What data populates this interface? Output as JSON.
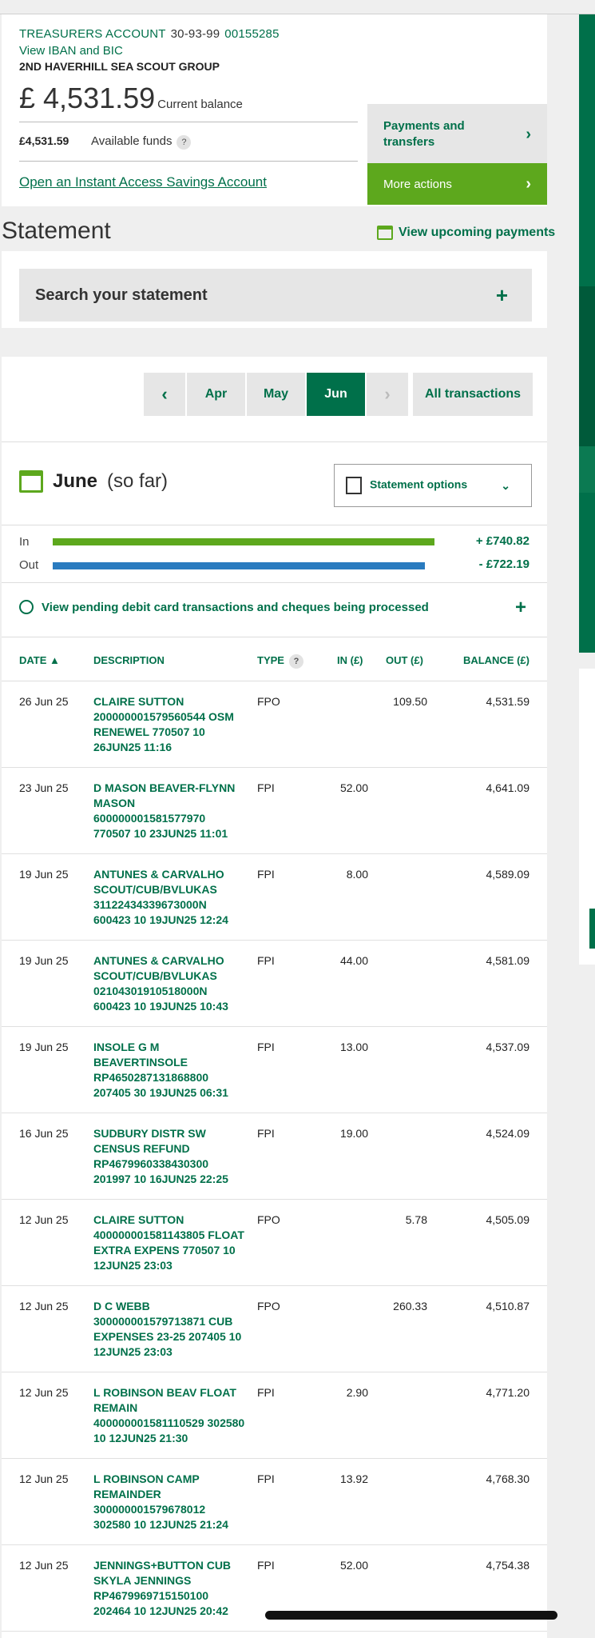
{
  "account": {
    "name": "TREASURERS ACCOUNT",
    "sort_code": "30-93-99",
    "number": "00155285",
    "iban_link": "View IBAN and BIC",
    "holder": "2ND HAVERHILL SEA SCOUT GROUP",
    "balance": "£ 4,531.59",
    "balance_label": "Current balance",
    "available": "£4,531.59",
    "available_label": "Available funds",
    "help": "?",
    "isa_link": "Open an Instant Access Savings Account",
    "payments_label": "Payments and transfers",
    "more_actions_label": "More actions"
  },
  "statement": {
    "title": "Statement",
    "upcoming_label": "View upcoming payments",
    "search_label": "Search your statement",
    "plus": "+"
  },
  "months": {
    "prev": "‹",
    "items": [
      "Apr",
      "May",
      "Jun"
    ],
    "next": "›",
    "all": "All transactions"
  },
  "period": {
    "title": "June",
    "subtitle": "(so far)",
    "options_label": "Statement options",
    "in_label": "In",
    "out_label": "Out",
    "in_total": "+ £740.82",
    "out_total": "- £722.19",
    "in_fraction": 1.0,
    "out_fraction": 0.975,
    "pending_label": "View pending debit card transactions and cheques being processed"
  },
  "table": {
    "headers": {
      "date": "DATE ▲",
      "description": "DESCRIPTION",
      "type": "TYPE",
      "in": "IN (£)",
      "out": "OUT (£)",
      "balance": "BALANCE (£)"
    },
    "rows": [
      {
        "date": "26 Jun 25",
        "desc": "CLAIRE SUTTON 200000001579560544 OSM RENEWEL 770507 10 26JUN25 11:16",
        "type": "FPO",
        "in": "",
        "out": "109.50",
        "bal": "4,531.59"
      },
      {
        "date": "23 Jun 25",
        "desc": "D MASON BEAVER-FLYNN MASON 600000001581577970 770507 10 23JUN25 11:01",
        "type": "FPI",
        "in": "52.00",
        "out": "",
        "bal": "4,641.09"
      },
      {
        "date": "19 Jun 25",
        "desc": "ANTUNES & CARVALHO SCOUT/CUB/BVLUKAS 31122434339673000N 600423 10 19JUN25 12:24",
        "type": "FPI",
        "in": "8.00",
        "out": "",
        "bal": "4,589.09"
      },
      {
        "date": "19 Jun 25",
        "desc": "ANTUNES & CARVALHO SCOUT/CUB/BVLUKAS 02104301910518000N 600423 10 19JUN25 10:43",
        "type": "FPI",
        "in": "44.00",
        "out": "",
        "bal": "4,581.09"
      },
      {
        "date": "19 Jun 25",
        "desc": "INSOLE G M BEAVERTINSOLE RP4650287131868800 207405 30 19JUN25 06:31",
        "type": "FPI",
        "in": "13.00",
        "out": "",
        "bal": "4,537.09"
      },
      {
        "date": "16 Jun 25",
        "desc": "SUDBURY DISTR SW CENSUS REFUND RP4679960338430300 201997 10 16JUN25 22:25",
        "type": "FPI",
        "in": "19.00",
        "out": "",
        "bal": "4,524.09"
      },
      {
        "date": "12 Jun 25",
        "desc": "CLAIRE SUTTON 400000001581143805 FLOAT EXTRA EXPENS 770507 10 12JUN25 23:03",
        "type": "FPO",
        "in": "",
        "out": "5.78",
        "bal": "4,505.09"
      },
      {
        "date": "12 Jun 25",
        "desc": "D C WEBB 300000001579713871 CUB EXPENSES 23-25 207405 10 12JUN25 23:03",
        "type": "FPO",
        "in": "",
        "out": "260.33",
        "bal": "4,510.87"
      },
      {
        "date": "12 Jun 25",
        "desc": "L ROBINSON BEAV FLOAT REMAIN 400000001581110529 302580 10 12JUN25 21:30",
        "type": "FPI",
        "in": "2.90",
        "out": "",
        "bal": "4,771.20"
      },
      {
        "date": "12 Jun 25",
        "desc": "L ROBINSON CAMP REMAINDER 300000001579678012 302580 10 12JUN25 21:24",
        "type": "FPI",
        "in": "13.92",
        "out": "",
        "bal": "4,768.30"
      },
      {
        "date": "12 Jun 25",
        "desc": "JENNINGS+BUTTON CUB SKYLA JENNINGS RP4679969715150100 202464 10 12JUN25 20:42",
        "type": "FPI",
        "in": "52.00",
        "out": "",
        "bal": "4,754.38"
      }
    ]
  },
  "colors": {
    "brand_green": "#00704a",
    "accent_green": "#5da81d",
    "out_blue": "#2a7bbf"
  }
}
